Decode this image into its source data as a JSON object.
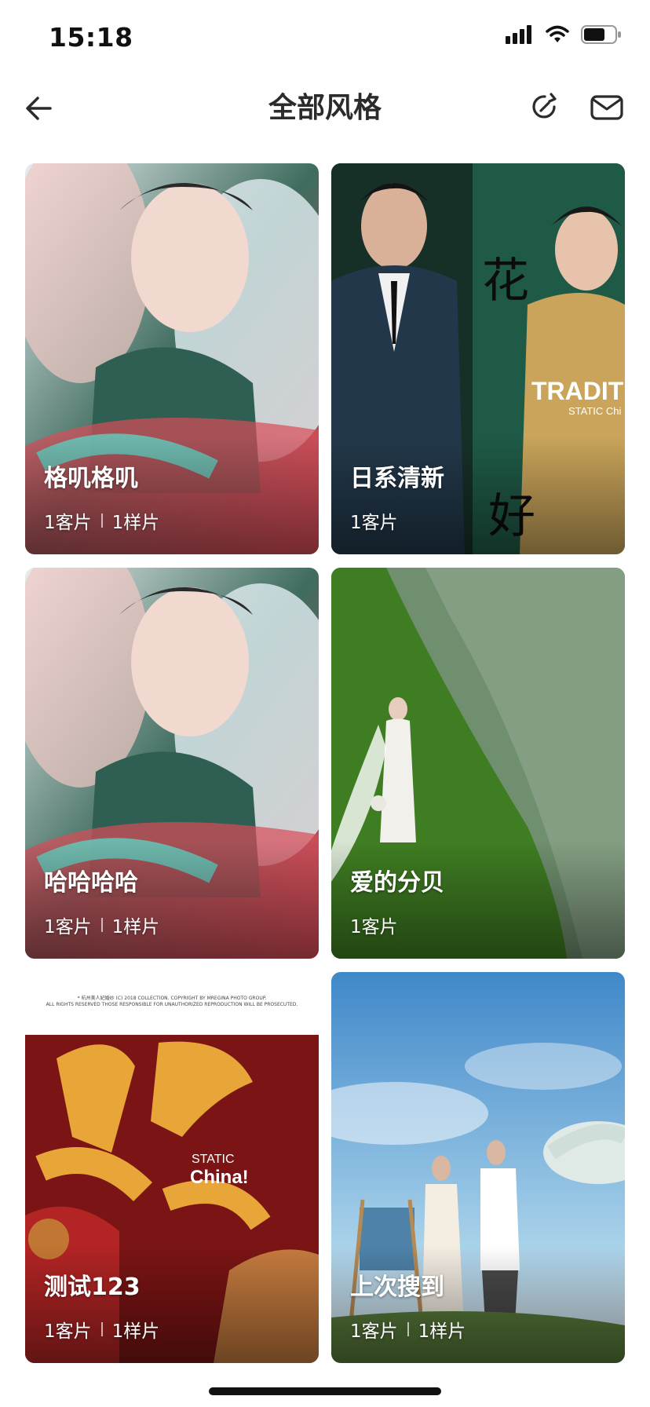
{
  "status_bar": {
    "time": "15:18"
  },
  "nav": {
    "title": "全部风格"
  },
  "cards": [
    {
      "title": "格叽格叽",
      "client": "1客片",
      "sample": "1样片"
    },
    {
      "title": "日系清新",
      "client": "1客片",
      "sample": ""
    },
    {
      "title": "哈哈哈哈",
      "client": "1客片",
      "sample": "1样片"
    },
    {
      "title": "爱的分贝",
      "client": "1客片",
      "sample": ""
    },
    {
      "title": "测试123",
      "client": "1客片",
      "sample": "1样片"
    },
    {
      "title": "上次搜到",
      "client": "1客片",
      "sample": "1样片"
    }
  ],
  "poster_texts": {
    "traditional": "TRADIT",
    "static_china_small": "STATIC Chi",
    "static": "STATIC",
    "china": "China!",
    "copyright_line1": "* 杭州美人妃婚纱 (C) 2018 COLLECTION. COPYRIGHT BY MREGINA PHOTO GROUP.",
    "copyright_line2": "ALL RIGHTS RESERVED THOSE RESPONSIBLE FOR UNAUTHORIZED REPRODUCTION WILL BE PROSECUTED."
  },
  "colors": {
    "accent_bg": "#ffffff",
    "label": "#ffffff"
  }
}
